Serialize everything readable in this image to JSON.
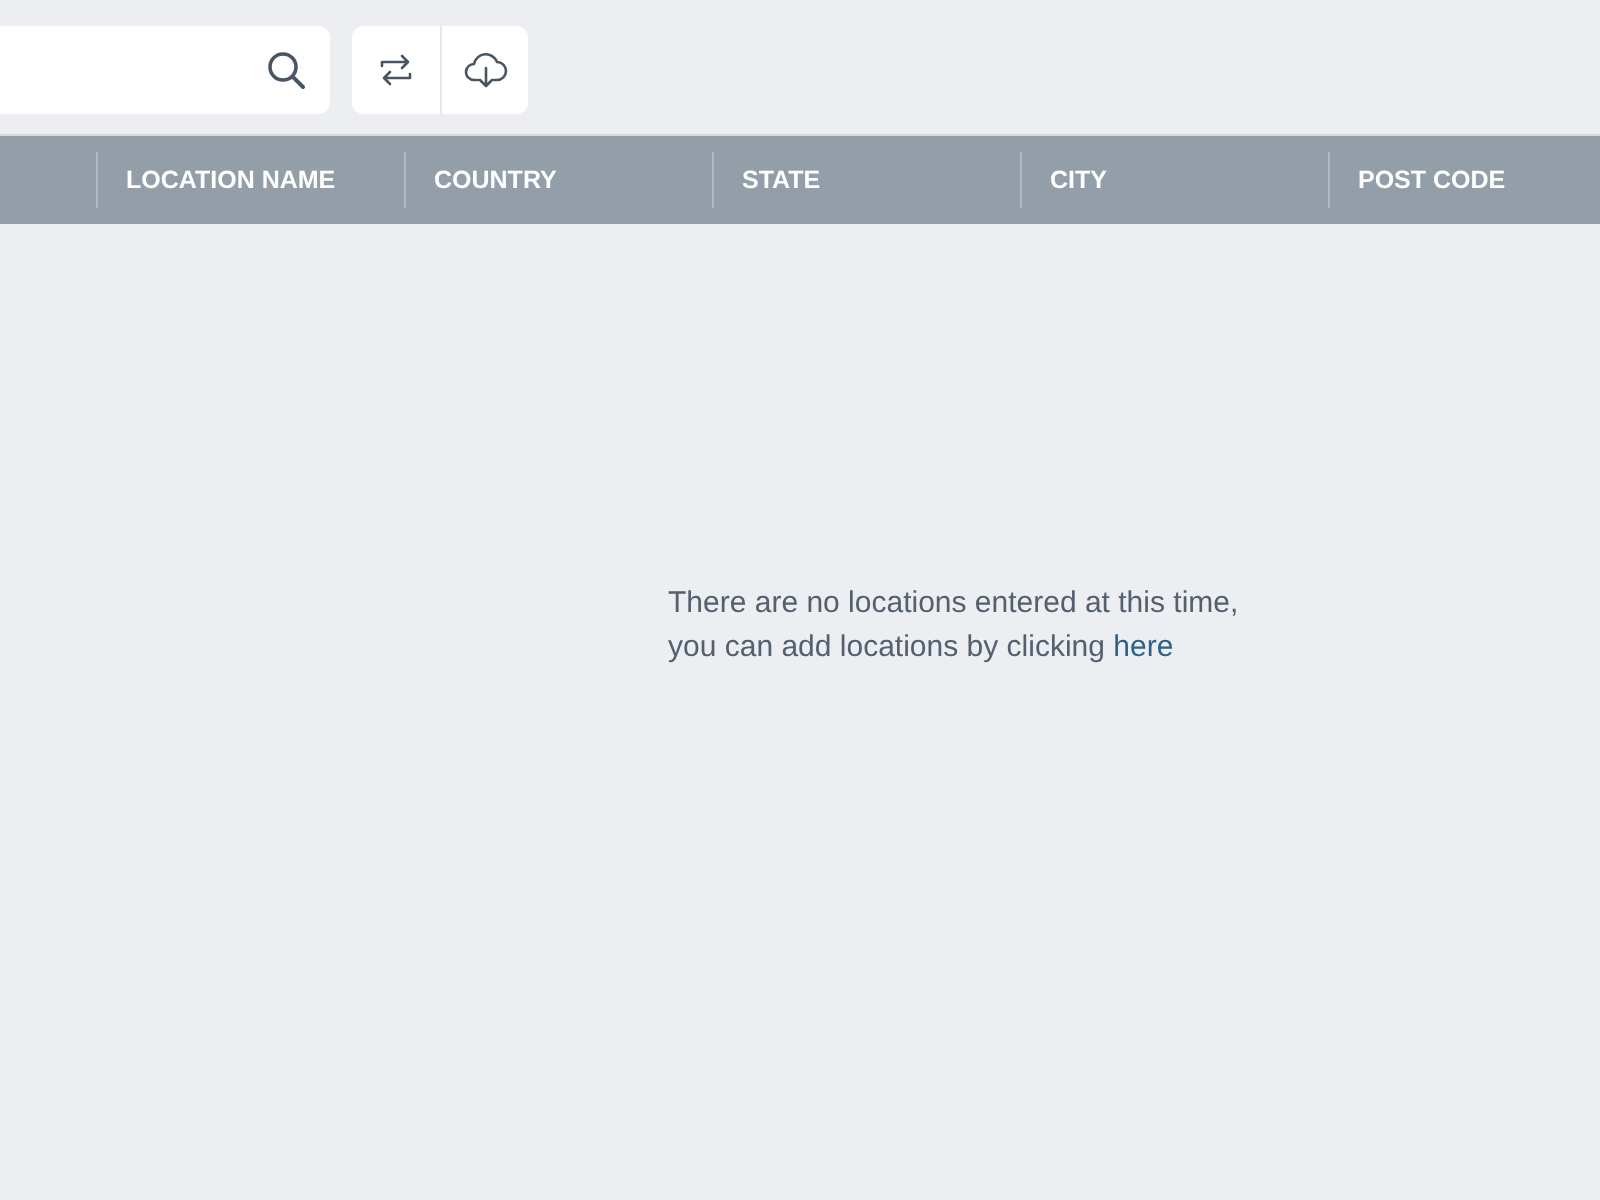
{
  "table": {
    "columns": [
      "LOCATION NAME",
      "COUNTRY",
      "STATE",
      "CITY",
      "POST CODE"
    ]
  },
  "empty_message": {
    "text": "There are no locations entered at this time, you can add locations by clicking",
    "link": "here"
  }
}
